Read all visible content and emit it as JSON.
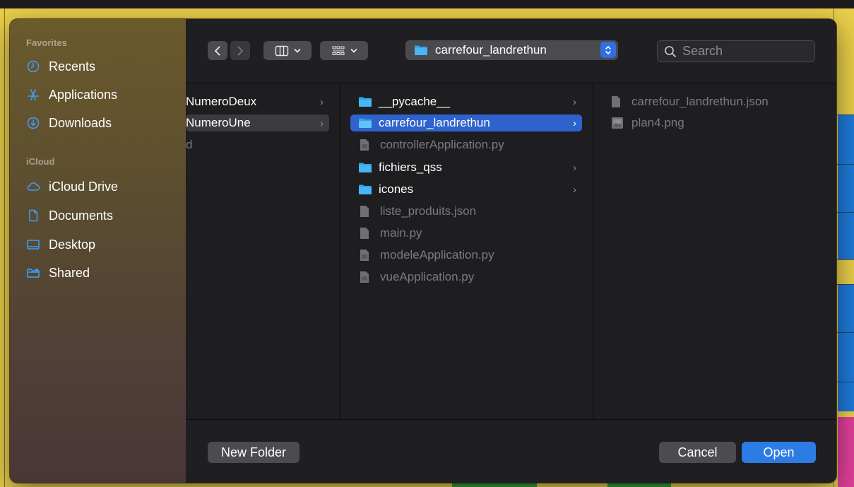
{
  "sidebar": {
    "favorites_title": "Favorites",
    "favorites": [
      {
        "label": "Recents",
        "icon": "clock-icon"
      },
      {
        "label": "Applications",
        "icon": "applications-icon"
      },
      {
        "label": "Downloads",
        "icon": "download-icon"
      }
    ],
    "icloud_title": "iCloud",
    "icloud": [
      {
        "label": "iCloud Drive",
        "icon": "cloud-icon"
      },
      {
        "label": "Documents",
        "icon": "document-icon"
      },
      {
        "label": "Desktop",
        "icon": "desktop-icon"
      },
      {
        "label": "Shared",
        "icon": "shared-folder-icon"
      }
    ]
  },
  "toolbar": {
    "location": "carrefour_landrethun",
    "search_placeholder": "Search"
  },
  "columns": {
    "col1": [
      {
        "label": "NumeroDeux",
        "type": "folder"
      },
      {
        "label": "NumeroUne",
        "type": "folder",
        "selected": true
      },
      {
        "label": "d",
        "type": "file"
      }
    ],
    "col2": [
      {
        "label": "__pycache__",
        "type": "folder"
      },
      {
        "label": "carrefour_landrethun",
        "type": "folder",
        "selected": true
      },
      {
        "label": "controllerApplication.py",
        "type": "file"
      },
      {
        "label": "fichiers_qss",
        "type": "folder"
      },
      {
        "label": "icones",
        "type": "folder"
      },
      {
        "label": "liste_produits.json",
        "type": "file"
      },
      {
        "label": "main.py",
        "type": "file"
      },
      {
        "label": "modeleApplication.py",
        "type": "file"
      },
      {
        "label": "vueApplication.py",
        "type": "file"
      }
    ],
    "col3": [
      {
        "label": "carrefour_landrethun.json",
        "type": "file"
      },
      {
        "label": "plan4.png",
        "type": "image"
      }
    ]
  },
  "buttons": {
    "new_folder": "New Folder",
    "cancel": "Cancel",
    "open": "Open"
  },
  "colors": {
    "accent": "#2f62cc",
    "open_button": "#2d7be5",
    "folder": "#2fa6f0"
  }
}
